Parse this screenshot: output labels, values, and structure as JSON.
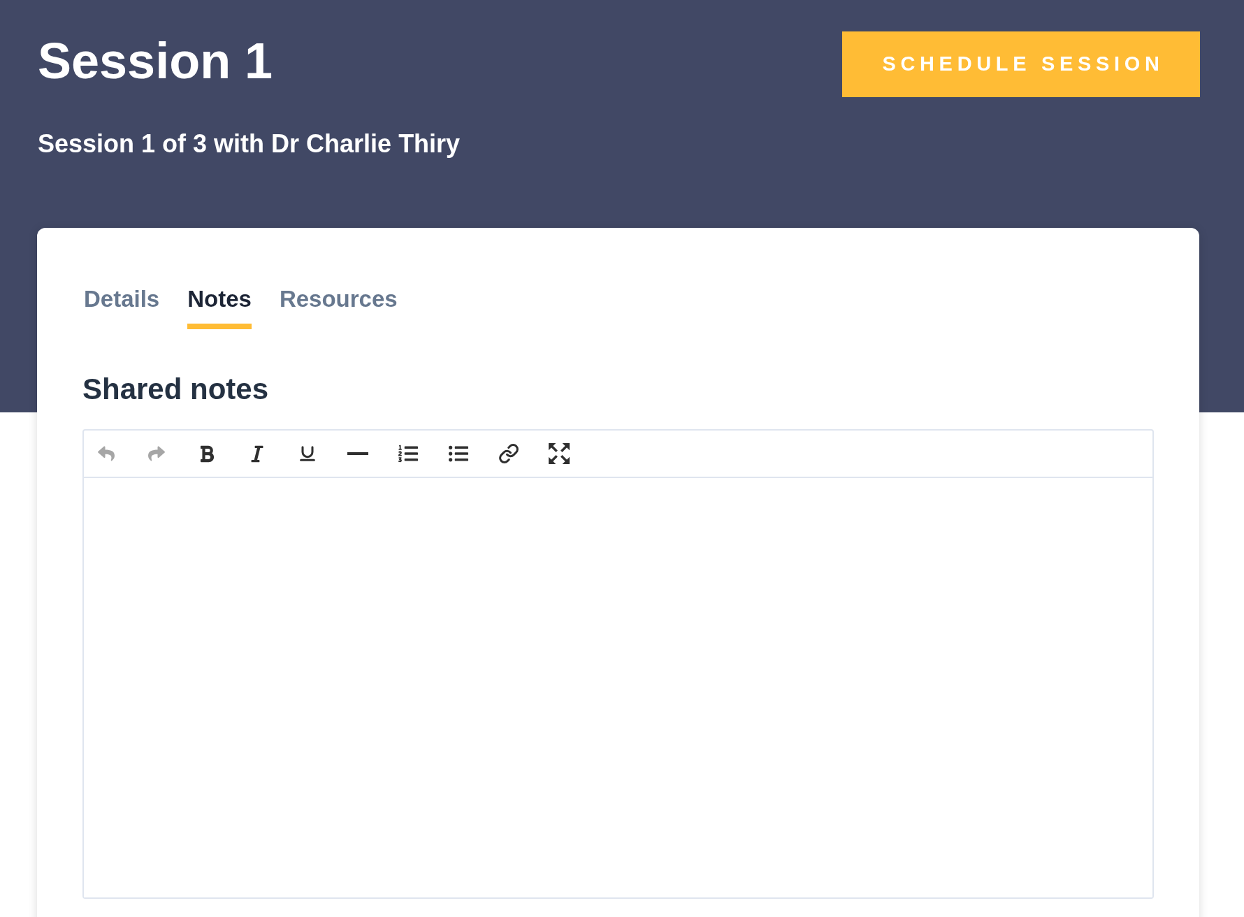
{
  "header": {
    "title": "Session 1",
    "subtitle": "Session 1 of 3 with Dr Charlie Thiry",
    "action": {
      "label": "SCHEDULE SESSION"
    }
  },
  "tabs": [
    {
      "label": "Details",
      "selected": false
    },
    {
      "label": "Notes",
      "selected": true
    },
    {
      "label": "Resources",
      "selected": false
    }
  ],
  "section": {
    "title": "Shared notes"
  },
  "editor": {
    "toolbar": [
      {
        "kind": "undo",
        "disabled": true
      },
      {
        "kind": "redo",
        "disabled": true
      },
      {
        "kind": "bold",
        "disabled": false
      },
      {
        "kind": "italic",
        "disabled": false
      },
      {
        "kind": "underline",
        "disabled": false
      },
      {
        "kind": "rule",
        "disabled": false
      },
      {
        "kind": "ordered",
        "disabled": false
      },
      {
        "kind": "bullets",
        "disabled": false
      },
      {
        "kind": "link",
        "disabled": false
      },
      {
        "kind": "fullscreen",
        "disabled": false
      }
    ]
  }
}
